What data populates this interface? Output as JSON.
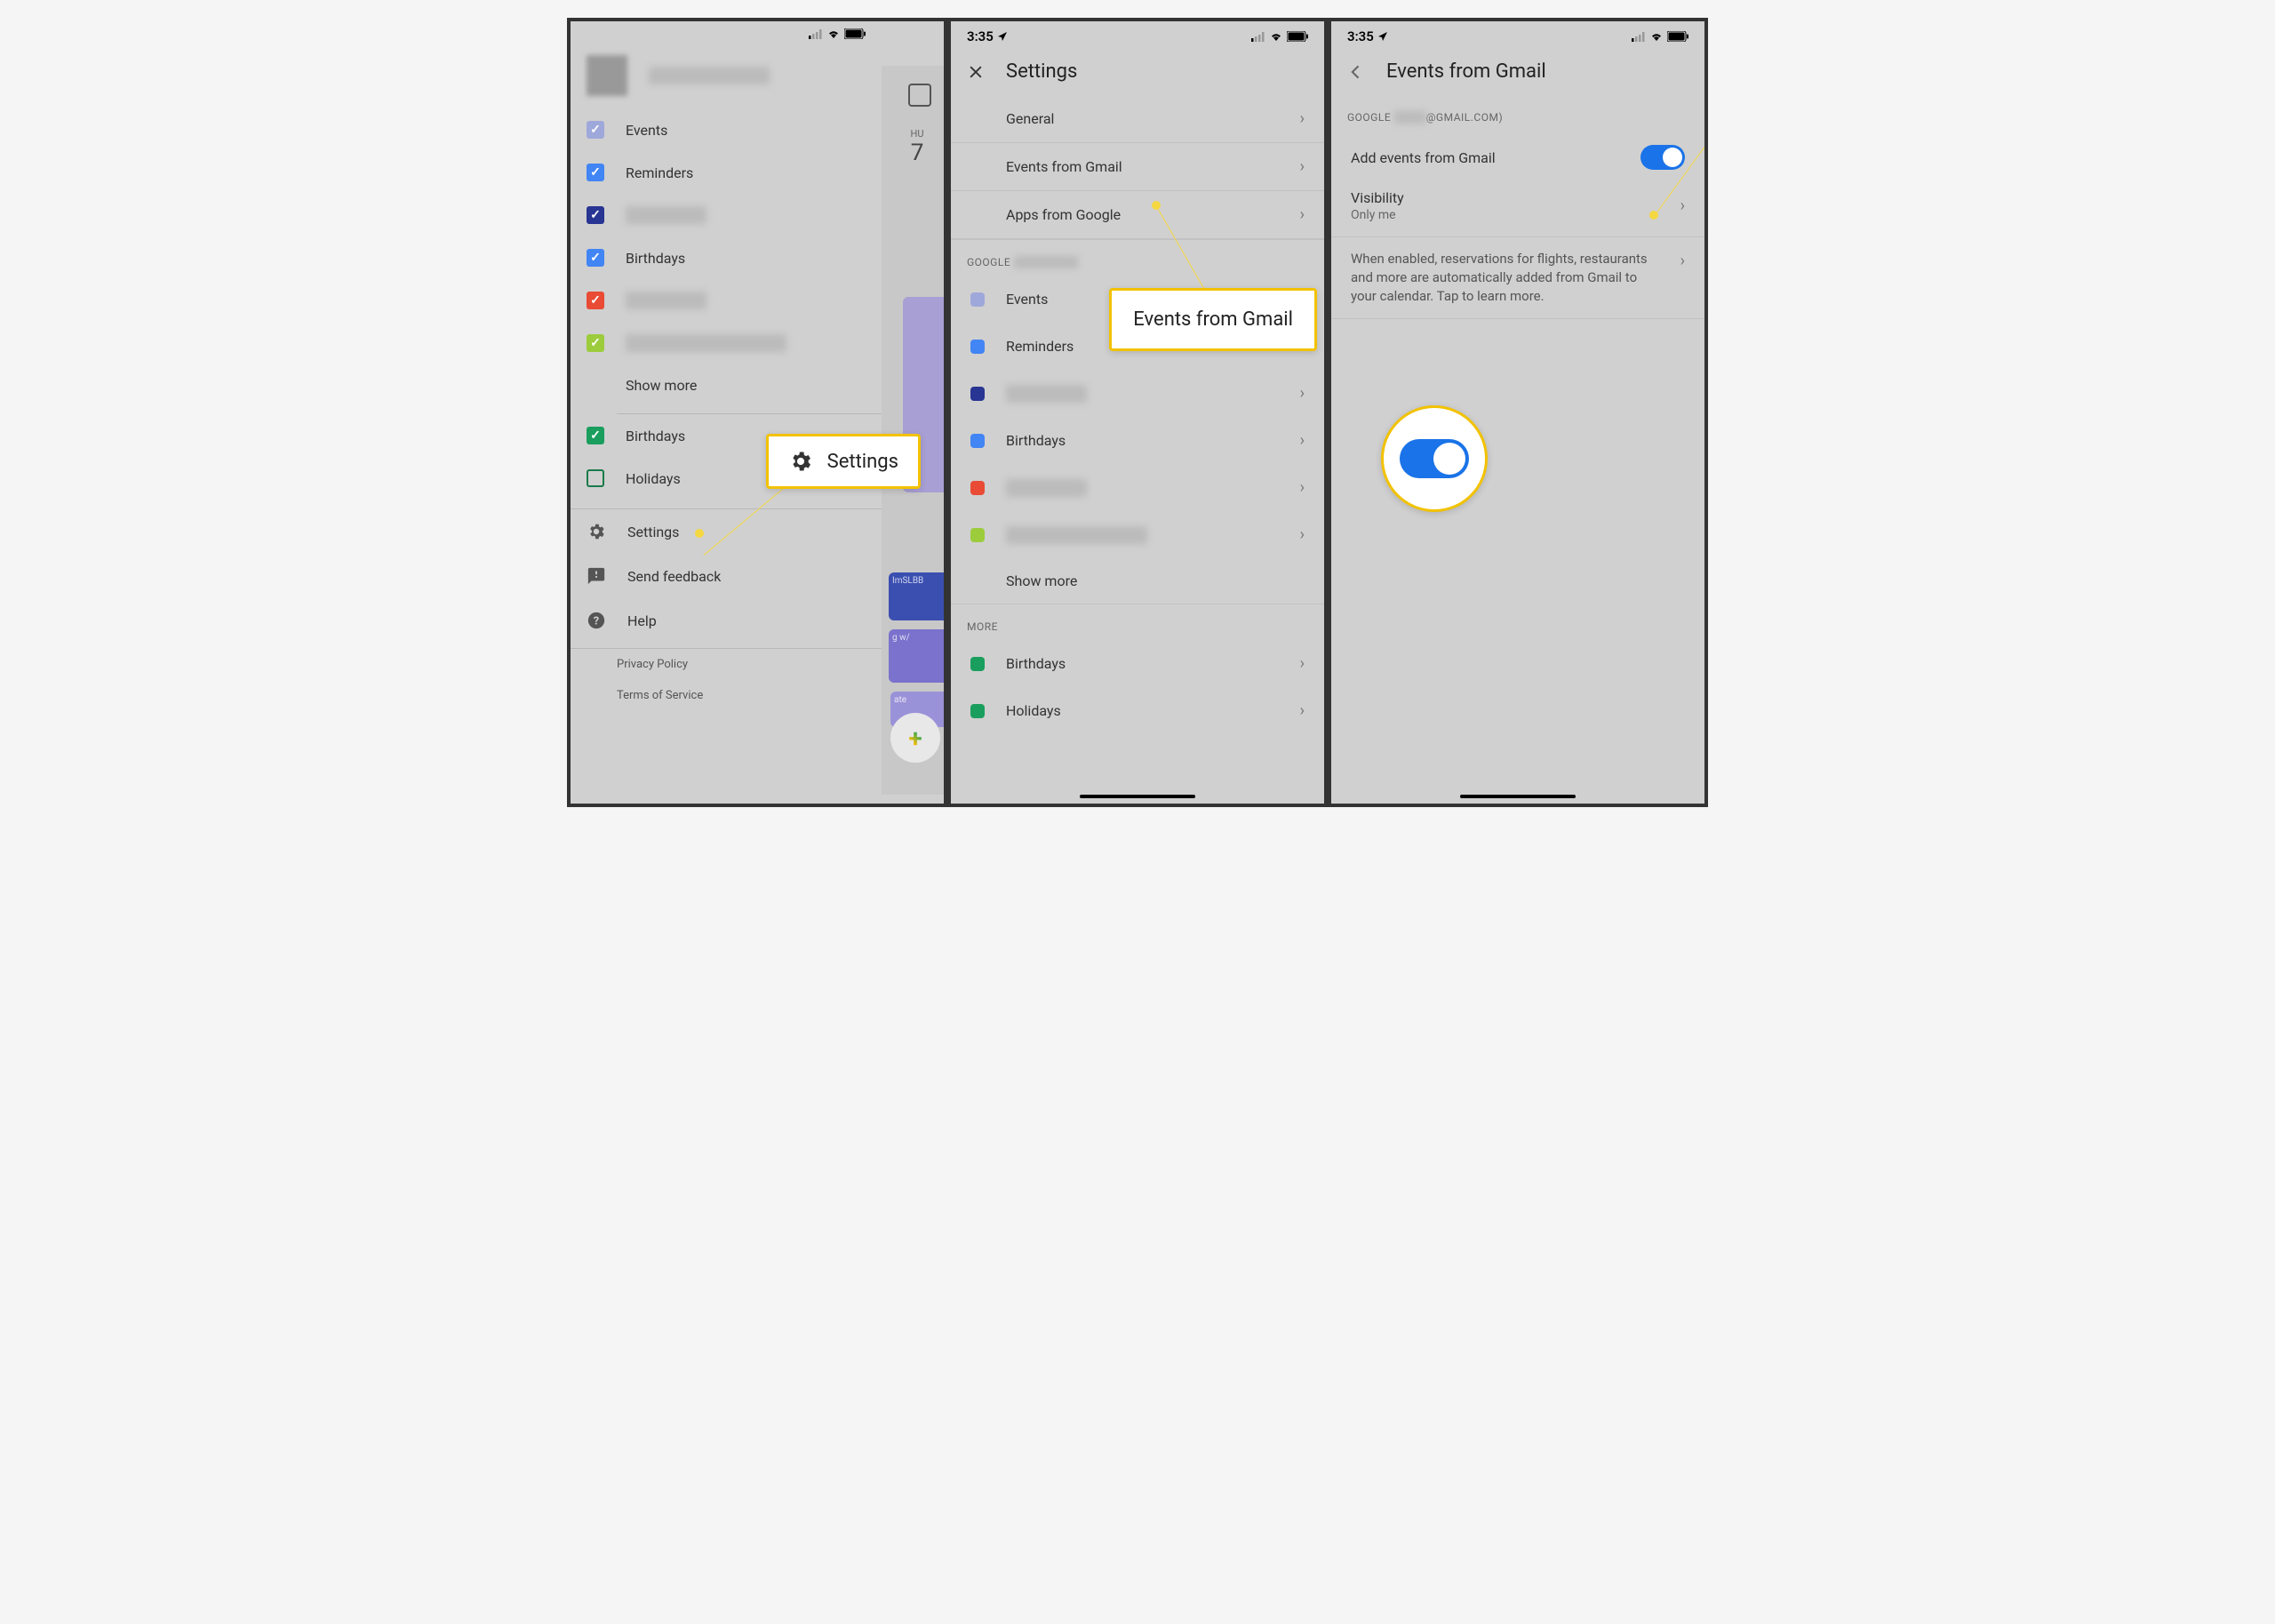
{
  "status": {
    "time": "3:35",
    "location_icon": "location-arrow"
  },
  "phone1": {
    "account_name": "████████████",
    "calendars": [
      {
        "label": "Events",
        "color": "#9fa8da",
        "checked": true
      },
      {
        "label": "Reminders",
        "color": "#4285f4",
        "checked": true
      },
      {
        "label": "████████",
        "color": "#283593",
        "checked": true
      },
      {
        "label": "Birthdays",
        "color": "#4285f4",
        "checked": true
      },
      {
        "label": "████████",
        "color": "#e94b35",
        "checked": true
      },
      {
        "label": "████████████████",
        "color": "#9ccc3c",
        "checked": true
      }
    ],
    "show_more": "Show more",
    "more_cals": [
      {
        "label": "Birthdays",
        "color": "#1a9e5e",
        "checked": true
      },
      {
        "label": "Holidays",
        "color": "#1a7a4a",
        "checked": false
      }
    ],
    "menu": {
      "settings": "Settings",
      "feedback": "Send feedback",
      "help": "Help"
    },
    "footer": {
      "privacy": "Privacy Policy",
      "terms": "Terms of Service"
    },
    "bg": {
      "day_abbr": "HU",
      "day_num": "7",
      "ev2": "ImSLBB",
      "ev3": "g w/",
      "ev4": "ate"
    },
    "callout_settings": "Settings"
  },
  "phone2": {
    "title": "Settings",
    "items_top": [
      {
        "label": "General"
      },
      {
        "label": "Events from Gmail"
      },
      {
        "label": "Apps from Google"
      }
    ],
    "google_section": "GOOGLE",
    "google_items": [
      {
        "label": "Events",
        "color": "#9fa8da"
      },
      {
        "label": "Reminders",
        "color": "#4285f4"
      },
      {
        "label": "████████",
        "color": "#283593"
      },
      {
        "label": "Birthdays",
        "color": "#4285f4"
      },
      {
        "label": "████████",
        "color": "#e94b35"
      },
      {
        "label": "██████████████",
        "color": "#9ccc3c"
      }
    ],
    "show_more": "Show more",
    "more_section": "MORE",
    "more_items": [
      {
        "label": "Birthdays",
        "color": "#1a9e5e"
      },
      {
        "label": "Holidays",
        "color": "#1a9e5e"
      }
    ],
    "callout": "Events from Gmail"
  },
  "phone3": {
    "title": "Events from Gmail",
    "google_label": "GOOGLE",
    "email_suffix": "@GMAIL.COM)",
    "add_events": "Add events from Gmail",
    "visibility": "Visibility",
    "visibility_value": "Only me",
    "description": "When enabled, reservations for flights, restaurants and more are automatically added from Gmail to your calendar. Tap to learn more."
  }
}
